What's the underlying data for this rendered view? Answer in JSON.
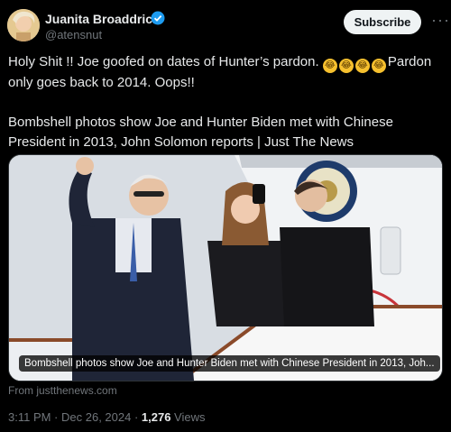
{
  "author": {
    "name": "Juanita Broaddrick",
    "handle": "@atensnut"
  },
  "subscribe_label": "Subscribe",
  "more_label": "···",
  "tweet": {
    "line1_before": "Holy Shit !!   Joe goofed on dates of Hunter’s pardon. ",
    "line1_after": "Pardon",
    "line2": "only goes back to 2014. Oops!!",
    "line3": "Bombshell photos show Joe and Hunter Biden met with Chinese",
    "line4": "President in 2013, John Solomon reports | Just The News",
    "emoji_count": "4"
  },
  "card": {
    "caption": "Bombshell photos show Joe and Hunter Biden met with Chinese President in 2013, Joh...",
    "source": "From justthenews.com"
  },
  "meta": {
    "time": "3:11 PM · Dec 26, 2024 · ",
    "views_count": "1,276",
    "views_label": " Views"
  },
  "colors": {
    "background": "#000000",
    "text": "#e7e9ea",
    "muted": "#71767b",
    "verified": "#1d9bf0"
  }
}
